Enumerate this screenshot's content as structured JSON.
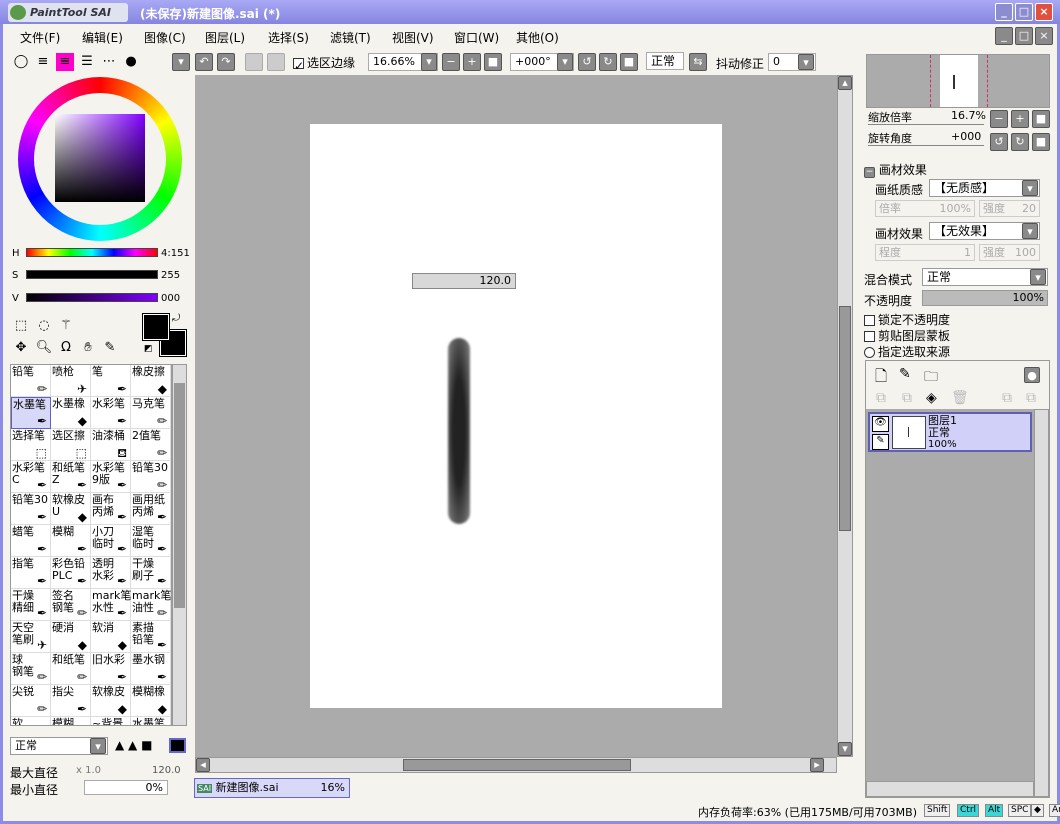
{
  "app": {
    "logo_text": "PaintTool SAI",
    "title": "(未保存)新建图像.sai (*)"
  },
  "window_buttons": [
    "_",
    "□",
    "×"
  ],
  "menu": [
    "文件(F)",
    "编辑(E)",
    "图像(C)",
    "图层(L)",
    "选择(S)",
    "滤镜(T)",
    "视图(V)",
    "窗口(W)",
    "其他(O)"
  ],
  "toolbar": {
    "selection_edge_label": "选区边缘",
    "selection_edge_checked": true,
    "zoom": "16.66%",
    "rotation": "+000°",
    "blend": "正常",
    "stabilizer_label": "抖动修正",
    "stabilizer": "0"
  },
  "color": {
    "h_label": "H",
    "h_value": "4:151",
    "s_label": "S",
    "s_value": "255",
    "v_label": "V",
    "v_value": "000",
    "primary": "#000000",
    "secondary": "#000000"
  },
  "brushes": [
    {
      "name": "铅笔",
      "icon": "pencil-icon"
    },
    {
      "name": "喷枪",
      "icon": "airbrush-icon"
    },
    {
      "name": "笔",
      "icon": "pen-icon"
    },
    {
      "name": "橡皮擦",
      "icon": "eraser-icon"
    },
    {
      "name": "水墨笔",
      "icon": "pen-icon",
      "selected": true
    },
    {
      "name": "水墨橡",
      "icon": "eraser-icon"
    },
    {
      "name": "水彩笔",
      "icon": "watercolor-icon"
    },
    {
      "name": "马克笔",
      "icon": "marker-icon"
    },
    {
      "name": "选择笔",
      "icon": "select-pen-icon"
    },
    {
      "name": "选区擦",
      "icon": "select-eraser-icon"
    },
    {
      "name": "油漆桶",
      "icon": "bucket-icon"
    },
    {
      "name": "2值笔",
      "icon": "pencil-icon"
    },
    {
      "name": "水彩笔\nC",
      "icon": "watercolor-icon"
    },
    {
      "name": "和纸笔\nZ",
      "icon": "pen-icon"
    },
    {
      "name": "水彩笔\n9版",
      "icon": "pen-icon"
    },
    {
      "name": "铅笔30",
      "icon": "pencil-icon"
    },
    {
      "name": "铅笔30",
      "icon": "pen-icon"
    },
    {
      "name": "软橡皮\nU",
      "icon": "eraser-icon"
    },
    {
      "name": "画布\n丙烯",
      "icon": "pen-icon"
    },
    {
      "name": "画用纸\n丙烯",
      "icon": "pen-icon"
    },
    {
      "name": "蜡笔",
      "icon": "pen-icon"
    },
    {
      "name": "模糊",
      "icon": "blur-icon"
    },
    {
      "name": "小刀\n临时",
      "icon": "pen-icon"
    },
    {
      "name": "湿笔\n临时",
      "icon": "watercolor-icon"
    },
    {
      "name": "指笔",
      "icon": "watercolor-icon"
    },
    {
      "name": "彩色铅\nPLC",
      "icon": "pen-icon"
    },
    {
      "name": "透明\n水彩",
      "icon": "pen-icon"
    },
    {
      "name": "干燥\n刷子",
      "icon": "pen-icon"
    },
    {
      "name": "干燥\n精细",
      "icon": "pen-icon"
    },
    {
      "name": "签名\n钢笔",
      "icon": "pencil-icon"
    },
    {
      "name": "mark笔\n水性",
      "icon": "watercolor-icon"
    },
    {
      "name": "mark笔\n油性",
      "icon": "pencil-icon"
    },
    {
      "name": "天空\n笔刷",
      "icon": "airbrush-icon"
    },
    {
      "name": "硬消",
      "icon": "eraser-icon"
    },
    {
      "name": "软消",
      "icon": "eraser-icon"
    },
    {
      "name": "素描\n铅笔",
      "icon": "pen-icon"
    },
    {
      "name": "球\n钢笔",
      "icon": "pencil-icon"
    },
    {
      "name": "和纸笔",
      "icon": "pencil-icon"
    },
    {
      "name": "旧水彩",
      "icon": "pen-icon"
    },
    {
      "name": "墨水钢",
      "icon": "pen-icon"
    },
    {
      "name": "尖锐",
      "icon": "pencil-icon"
    },
    {
      "name": "指尖",
      "icon": "watercolor-icon"
    },
    {
      "name": "软橡皮",
      "icon": "eraser-icon"
    },
    {
      "name": "模糊橡",
      "icon": "eraser-icon"
    },
    {
      "name": "软",
      "icon": ""
    },
    {
      "name": "模糊",
      "icon": ""
    },
    {
      "name": "~背景",
      "icon": ""
    },
    {
      "name": "水墨笔",
      "icon": ""
    }
  ],
  "brush_settings": {
    "blend": "正常",
    "max_size_label": "最大直径",
    "max_size_mult": "x 1.0",
    "max_size": "120.0",
    "min_size_label": "最小直径",
    "min_size": "0%"
  },
  "canvas": {
    "size_tooltip": "120.0"
  },
  "doc_tab": {
    "name": "新建图像.sai",
    "zoom": "16%"
  },
  "navigator": {
    "zoom_label": "缩放倍率",
    "zoom": "16.7%",
    "rotate_label": "旋转角度",
    "rotate": "+000"
  },
  "texture": {
    "header": "画材效果",
    "paper_label": "画纸质感",
    "paper": "【无质感】",
    "scale_label": "倍率",
    "scale": "100%",
    "strength_label": "强度",
    "strength": "20",
    "effect_label": "画材效果",
    "effect": "【无效果】",
    "degree_label": "程度",
    "degree": "1",
    "strength2_label": "强度",
    "strength2": "100"
  },
  "layer_props": {
    "blend_label": "混合模式",
    "blend": "正常",
    "opacity_label": "不透明度",
    "opacity": "100%",
    "opacity_value": 1.0,
    "lock_label": "锁定不透明度",
    "clip_label": "剪贴图层蒙板",
    "source_label": "指定选取来源"
  },
  "layers": [
    {
      "name": "图层1",
      "blend": "正常",
      "opacity": "100%",
      "visible": true,
      "selected": true
    }
  ],
  "status": {
    "memory": "内存负荷率:63% (已用175MB/可用703MB)",
    "keys": [
      "Shift",
      "Ctrl",
      "Alt",
      "SPC",
      "◆",
      "Any",
      "✎"
    ],
    "active_keys": [
      "Ctrl",
      "Alt"
    ]
  },
  "colors": {
    "titlebar": "#8c8ce8",
    "canvas_bg": "#ababab",
    "selection": "#d8d8f8"
  }
}
